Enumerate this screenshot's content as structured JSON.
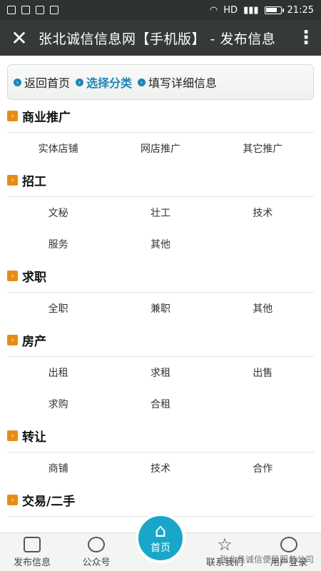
{
  "status_bar": {
    "time": "21:25",
    "network": "HD"
  },
  "header": {
    "title": "张北诚信信息网【手机版】 - 发布信息",
    "close_icon": "close-icon",
    "more_icon": "more-vertical-icon"
  },
  "breadcrumb": [
    "返回首页",
    "选择分类",
    "填写详细信息"
  ],
  "categories": [
    {
      "title": "商业推广",
      "items": [
        "实体店铺",
        "网店推广",
        "其它推广"
      ]
    },
    {
      "title": "招工",
      "items": [
        "文秘",
        "壮工",
        "技术",
        "服务",
        "其他"
      ]
    },
    {
      "title": "求职",
      "items": [
        "全职",
        "兼职",
        "其他"
      ]
    },
    {
      "title": "房产",
      "items": [
        "出租",
        "求租",
        "出售",
        "求购",
        "合租"
      ]
    },
    {
      "title": "转让",
      "items": [
        "商铺",
        "技术",
        "合作"
      ]
    },
    {
      "title": "交易/二手",
      "items": []
    }
  ],
  "bottom_nav": [
    {
      "label": "发布信息",
      "icon": "post-icon"
    },
    {
      "label": "公众号",
      "icon": "chat-icon"
    },
    {
      "label": "首页",
      "icon": "home-icon"
    },
    {
      "label": "联系我们",
      "icon": "star-icon"
    },
    {
      "label": "用户登录",
      "icon": "user-icon"
    }
  ],
  "watermark": "张北县诚信便民服务公司",
  "colors": {
    "accent": "#18a7c8",
    "category_icon": "#e98b18"
  },
  "battery_level": 0.75
}
